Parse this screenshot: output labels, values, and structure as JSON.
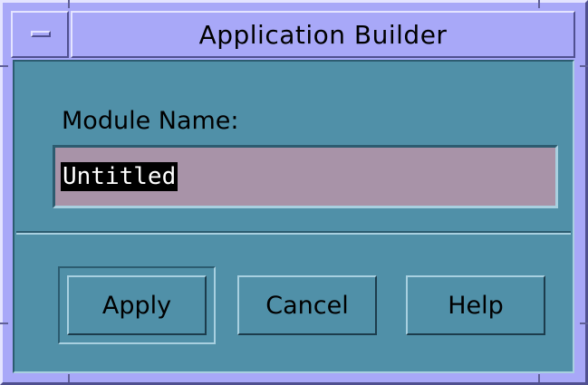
{
  "window": {
    "title": "Application Builder"
  },
  "form": {
    "module_name_label": "Module Name:",
    "module_name_value": "Untitled"
  },
  "buttons": {
    "apply_label": "Apply",
    "cancel_label": "Cancel",
    "help_label": "Help"
  },
  "colors": {
    "frame": "#a8a8f8",
    "client_background": "#5090a8",
    "text_field": "#a893a8",
    "selection": "#000000"
  },
  "icons": {
    "window_menu": "window-menu-icon"
  }
}
